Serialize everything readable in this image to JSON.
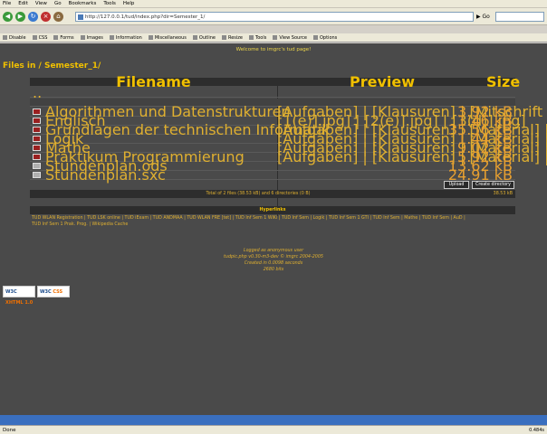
{
  "browser": {
    "menu": [
      "File",
      "Edit",
      "View",
      "Go",
      "Bookmarks",
      "Tools",
      "Help"
    ],
    "url": "http://127.0.0.1/tud/index.php?dir=Semester_1/",
    "go_label": "Go",
    "devbar": [
      "Disable",
      "CSS",
      "Forms",
      "Images",
      "Information",
      "Miscellaneous",
      "Outline",
      "Resize",
      "Tools",
      "View Source",
      "Options"
    ],
    "status": "Done",
    "status_right": "0.484s"
  },
  "page": {
    "welcome": "Welcome to imgrc's tud page!",
    "title": "Files in / Semester_1/",
    "columns": {
      "filename": "Filename",
      "preview": "Preview",
      "size": "Size"
    },
    "rows": [
      {
        "name": "..",
        "preview": "",
        "size": ""
      },
      {
        "name": "Algorithmen und Datenstrukturen",
        "preview": "[Aufgaben] | [Klausuren] | [Mitschrift Vorlesung]",
        "size": "3.92 kB"
      },
      {
        "name": "Englisch",
        "preview": "[1(e)].jpg] | [2(e)].jpg] | [3(d)].jpg]",
        "size": "1.46 kB"
      },
      {
        "name": "Grundlagen der technischen Informatik",
        "preview": "[Aufgaben] | [Klausuren] | [Material] | ...",
        "size": "35.56 kB"
      },
      {
        "name": "Logik",
        "preview": "[Aufgaben] | [Klausuren] | [Material] | ...",
        "size": "1.44 kB"
      },
      {
        "name": "Mathe",
        "preview": "[Aufgaben] | [Klausuren] | [Material] | ...",
        "size": "9.02 kB"
      },
      {
        "name": "Praktikum Programmierung",
        "preview": "[Aufgaben] | [Klausuren] | [Material] | ...",
        "size": "5.92 kB"
      },
      {
        "name": "Stundenplan.ods",
        "preview": "",
        "size": "13.62 kB"
      },
      {
        "name": "Stundenplan.sxc",
        "preview": "",
        "size": "24.91 kB"
      }
    ],
    "upload_label": "Upload",
    "create_dir_label": "Create directory",
    "total_text": "Total of 2 files (38.53 kB) and 6 directories (0 B)",
    "total_size": "38.53 kB",
    "hyperlinks_title": "Hyperlinks",
    "hyperlinks_line1": "TUD WLAN Registration | TUD LSK online | TUD iExam | TUD ANDMAA | TUD WLAN FRE [tet] | TUD Inf Sem 1 WiKi | TUD Inf Sem | Logik | TUD Inf Sem 1 GTI | TUD Inf Sem | Mathe | TUD Inf Sem | AuD |",
    "hyperlinks_line2": "TUD Inf Sem 1 Prak. Prog. | Wikipedia Cache",
    "footer": [
      "Logged as anonymous user",
      "tudpic.php v0.30-m3-dev © imgrc 2004-2005",
      "Created in 0.0098 seconds",
      "2680 bits"
    ],
    "badge_xhtml": "XHTML 1.0",
    "badge_css": "CSS"
  }
}
